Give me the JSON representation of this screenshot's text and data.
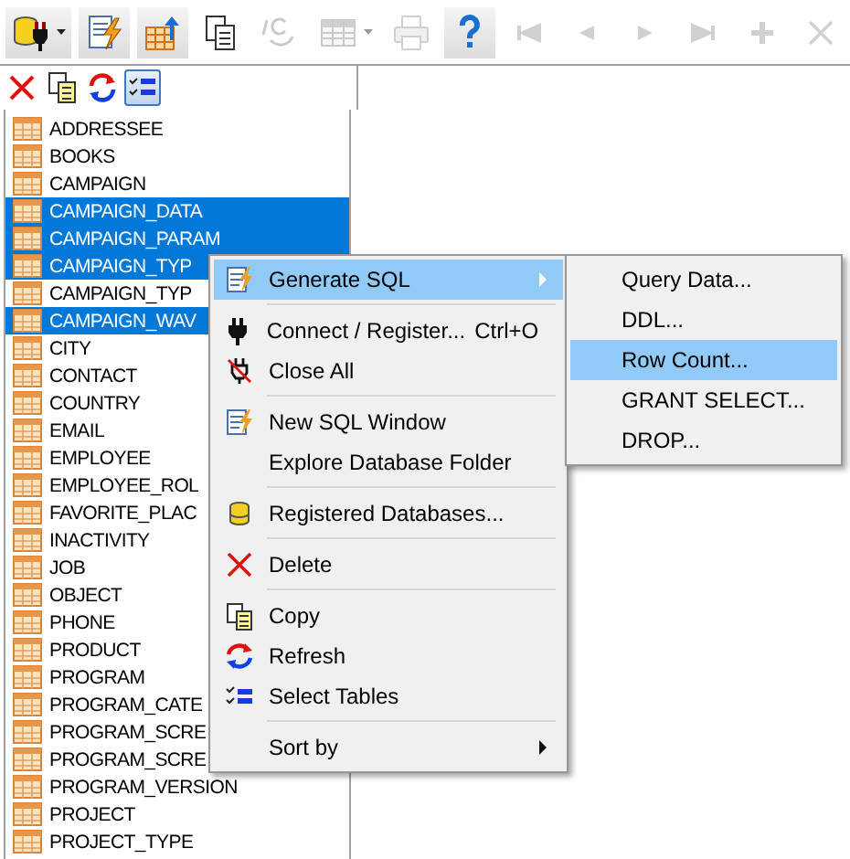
{
  "toolbar": [
    {
      "kind": "connect",
      "raised": true,
      "disabled": false,
      "dropdown": true
    },
    {
      "kind": "sql-editor",
      "raised": true,
      "disabled": false,
      "dropdown": false
    },
    {
      "kind": "export-table",
      "raised": true,
      "disabled": false,
      "dropdown": false
    },
    {
      "kind": "copy",
      "raised": false,
      "disabled": false,
      "dropdown": false
    },
    {
      "kind": "script",
      "raised": false,
      "disabled": true,
      "dropdown": false
    },
    {
      "kind": "grid",
      "raised": false,
      "disabled": true,
      "dropdown": true
    },
    {
      "kind": "print",
      "raised": false,
      "disabled": true,
      "dropdown": false
    },
    {
      "kind": "help",
      "raised": true,
      "disabled": false,
      "dropdown": false
    },
    {
      "kind": "first",
      "raised": false,
      "disabled": true,
      "dropdown": false
    },
    {
      "kind": "prev",
      "raised": false,
      "disabled": true,
      "dropdown": false
    },
    {
      "kind": "next",
      "raised": false,
      "disabled": true,
      "dropdown": false
    },
    {
      "kind": "last",
      "raised": false,
      "disabled": true,
      "dropdown": false
    },
    {
      "kind": "add",
      "raised": false,
      "disabled": true,
      "dropdown": false
    },
    {
      "kind": "cancel",
      "raised": false,
      "disabled": true,
      "dropdown": false
    }
  ],
  "panel_toolbar": [
    {
      "kind": "delete",
      "pressed": false
    },
    {
      "kind": "copy",
      "pressed": false
    },
    {
      "kind": "refresh",
      "pressed": false
    },
    {
      "kind": "select-tables",
      "pressed": true
    }
  ],
  "tables": [
    {
      "label": "ADDRESSEE",
      "selected": false
    },
    {
      "label": "BOOKS",
      "selected": false
    },
    {
      "label": "CAMPAIGN",
      "selected": false
    },
    {
      "label": "CAMPAIGN_DATA",
      "selected": true
    },
    {
      "label": "CAMPAIGN_PARAM",
      "selected": true
    },
    {
      "label": "CAMPAIGN_TYP",
      "selected": true
    },
    {
      "label": "CAMPAIGN_TYP",
      "selected": false
    },
    {
      "label": "CAMPAIGN_WAV",
      "selected": true
    },
    {
      "label": "CITY",
      "selected": false
    },
    {
      "label": "CONTACT",
      "selected": false
    },
    {
      "label": "COUNTRY",
      "selected": false
    },
    {
      "label": "EMAIL",
      "selected": false
    },
    {
      "label": "EMPLOYEE",
      "selected": false
    },
    {
      "label": "EMPLOYEE_ROL",
      "selected": false
    },
    {
      "label": "FAVORITE_PLAC",
      "selected": false
    },
    {
      "label": "INACTIVITY",
      "selected": false
    },
    {
      "label": "JOB",
      "selected": false
    },
    {
      "label": "OBJECT",
      "selected": false
    },
    {
      "label": "PHONE",
      "selected": false
    },
    {
      "label": "PRODUCT",
      "selected": false
    },
    {
      "label": "PROGRAM",
      "selected": false
    },
    {
      "label": "PROGRAM_CATE",
      "selected": false
    },
    {
      "label": "PROGRAM_SCRE",
      "selected": false
    },
    {
      "label": "PROGRAM_SCRE",
      "selected": false
    },
    {
      "label": "PROGRAM_VERSION",
      "selected": false
    },
    {
      "label": "PROJECT",
      "selected": false
    },
    {
      "label": "PROJECT_TYPE",
      "selected": false
    }
  ],
  "context_menu": [
    [
      {
        "kind": "generate",
        "label": "Generate SQL",
        "selected": true,
        "submenu": true
      }
    ],
    [
      {
        "kind": "connect",
        "label": "Connect / Register...",
        "shortcut": "Ctrl+O",
        "selected": false,
        "submenu": false
      },
      {
        "kind": "close-all",
        "label": "Close All",
        "selected": false,
        "submenu": false
      }
    ],
    [
      {
        "kind": "generate",
        "label": "New SQL Window",
        "selected": false,
        "submenu": false
      },
      {
        "kind": "none",
        "label": "Explore Database Folder",
        "selected": false,
        "submenu": false
      }
    ],
    [
      {
        "kind": "databases",
        "label": "Registered Databases...",
        "selected": false,
        "submenu": false
      }
    ],
    [
      {
        "kind": "delete",
        "label": "Delete",
        "selected": false,
        "submenu": false
      }
    ],
    [
      {
        "kind": "copy",
        "label": "Copy",
        "selected": false,
        "submenu": false
      },
      {
        "kind": "refresh",
        "label": "Refresh",
        "selected": false,
        "submenu": false
      },
      {
        "kind": "select-tables",
        "label": "Select Tables",
        "selected": false,
        "submenu": false
      }
    ],
    [
      {
        "kind": "none",
        "label": "Sort by",
        "selected": false,
        "submenu": true
      }
    ]
  ],
  "submenu": [
    {
      "label": "Query Data...",
      "selected": false
    },
    {
      "label": "DDL...",
      "selected": false
    },
    {
      "label": "Row Count...",
      "selected": true
    },
    {
      "label": "GRANT SELECT...",
      "selected": false
    },
    {
      "label": "DROP...",
      "selected": false
    }
  ]
}
